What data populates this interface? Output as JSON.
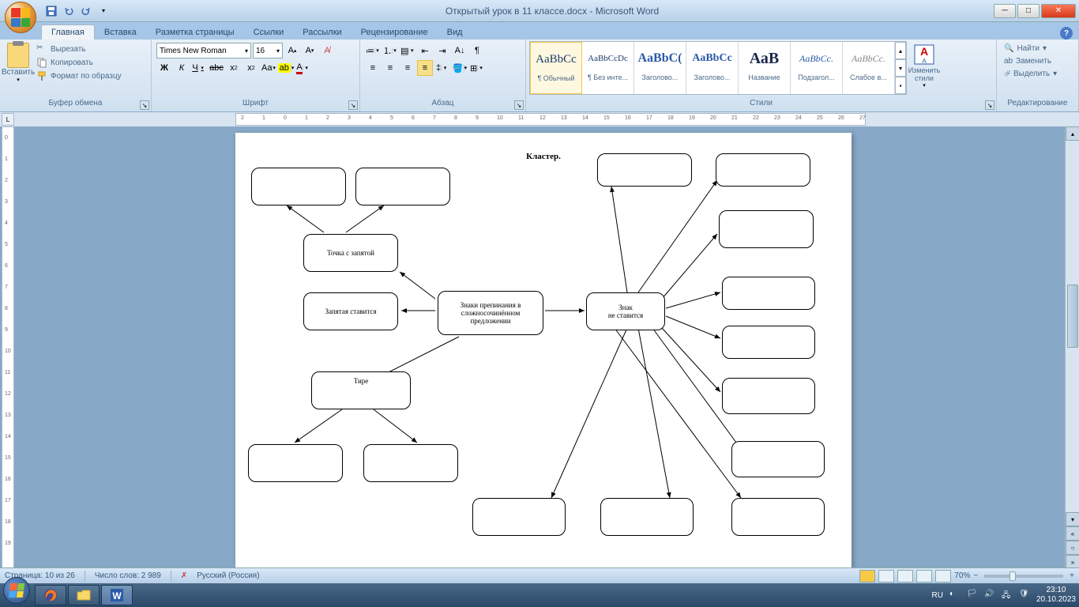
{
  "title": "Открытый урок в 11 классе.docx - Microsoft Word",
  "tabs": [
    "Главная",
    "Вставка",
    "Разметка страницы",
    "Ссылки",
    "Рассылки",
    "Рецензирование",
    "Вид"
  ],
  "active_tab": 0,
  "clipboard": {
    "paste": "Вставить",
    "cut": "Вырезать",
    "copy": "Копировать",
    "format": "Формат по образцу",
    "group": "Буфер обмена"
  },
  "font": {
    "name": "Times New Roman",
    "size": "16",
    "group": "Шрифт",
    "bold": "Ж",
    "italic": "К",
    "underline": "Ч"
  },
  "paragraph": {
    "group": "Абзац"
  },
  "styles": {
    "group": "Стили",
    "items": [
      {
        "preview": "AaBbCc",
        "name": "¶ Обычный",
        "size": "15px"
      },
      {
        "preview": "AaBbCcDc",
        "name": "¶ Без инте...",
        "size": "11px"
      },
      {
        "preview": "AaBbC(",
        "name": "Заголово...",
        "size": "16px",
        "color": "#2a5aa8",
        "bold": true
      },
      {
        "preview": "AaBbCc",
        "name": "Заголово...",
        "size": "14px",
        "color": "#2a5aa8",
        "bold": true
      },
      {
        "preview": "АаВ",
        "name": "Название",
        "size": "20px",
        "color": "#1a2a4a",
        "bold": true
      },
      {
        "preview": "AaBbCc.",
        "name": "Подзагол...",
        "size": "12px",
        "color": "#2a5aa8",
        "italic": true
      },
      {
        "preview": "AaBbCc.",
        "name": "Слабое в...",
        "size": "12px",
        "color": "#888",
        "italic": true
      }
    ],
    "change": "Изменить стили"
  },
  "editing": {
    "find": "Найти",
    "replace": "Заменить",
    "select": "Выделить",
    "group": "Редактирование"
  },
  "status": {
    "page": "Страница: 10 из 26",
    "words": "Число слов: 2 989",
    "lang": "Русский (Россия)",
    "zoom": "70%"
  },
  "tray": {
    "lang": "RU",
    "time": "23:10",
    "date": "20.10.2023"
  },
  "diagram": {
    "title": "Кластер.",
    "center": "Знаки препинания  в сложносочинённом предложении",
    "semicolon": "Точка с запятой",
    "comma": "Запятая ставится",
    "dash": "Тире",
    "nosign": "Знак\nне ставится"
  }
}
